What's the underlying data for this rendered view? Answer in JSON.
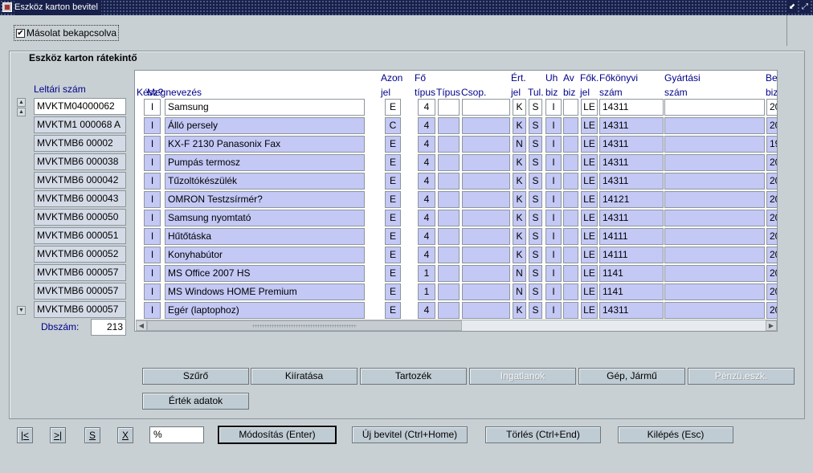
{
  "window": {
    "title": "Eszköz karton bevitel",
    "min_glyph": "⬋",
    "max_glyph": "⤢"
  },
  "copy_toggle": {
    "label": "Másolat bekapcsolva",
    "checked": true,
    "check_glyph": "✔"
  },
  "panel": {
    "title": "Eszköz karton rátekintő"
  },
  "left_column": {
    "header": "Leltári szám",
    "up_glyph": "▲",
    "down_glyph": "▼"
  },
  "columns": [
    {
      "key": "kesz",
      "label": "Kész?"
    },
    {
      "key": "megnevezes",
      "label": "Megnevezés"
    },
    {
      "key": "azon",
      "label": "Azon\njel"
    },
    {
      "key": "fotipus",
      "label": "Fő\ntípus"
    },
    {
      "key": "tipus",
      "label": "Típus"
    },
    {
      "key": "csop",
      "label": "Csop."
    },
    {
      "key": "ert",
      "label": "Ért.\njel"
    },
    {
      "key": "tul",
      "label": "Tul."
    },
    {
      "key": "uh",
      "label": "Uh\nbiz"
    },
    {
      "key": "av",
      "label": "Av\nbiz"
    },
    {
      "key": "fok",
      "label": "Fők.\njel"
    },
    {
      "key": "fokonyvi",
      "label": "Főkönyvi\nszám"
    },
    {
      "key": "gyartasi",
      "label": "Gyártási\nszám"
    },
    {
      "key": "be",
      "label": "Be\nbiz"
    }
  ],
  "rows": [
    {
      "leltari": "MVKTM04000062",
      "kesz": "I",
      "megnevezes": "Samsung",
      "azon": "E",
      "fotipus": "4",
      "tipus": "",
      "csop": "",
      "ert": "K",
      "tul": "S",
      "uh": "I",
      "av": "",
      "fok": "LE",
      "fokonyvi": "14311",
      "gyartasi": "",
      "be": "20"
    },
    {
      "leltari": "MVKTM1 000068 A",
      "kesz": "I",
      "megnevezes": "Álló persely",
      "azon": "C",
      "fotipus": "4",
      "tipus": "",
      "csop": "",
      "ert": "K",
      "tul": "S",
      "uh": "I",
      "av": "",
      "fok": "LE",
      "fokonyvi": "14311",
      "gyartasi": "",
      "be": "20"
    },
    {
      "leltari": "MVKTMB6 00002",
      "kesz": "I",
      "megnevezes": "KX-F 2130 Panasonix Fax",
      "azon": "E",
      "fotipus": "4",
      "tipus": "",
      "csop": "",
      "ert": "N",
      "tul": "S",
      "uh": "I",
      "av": "",
      "fok": "LE",
      "fokonyvi": "14311",
      "gyartasi": "",
      "be": "19"
    },
    {
      "leltari": "MVKTMB6 000038",
      "kesz": "I",
      "megnevezes": "Pumpás termosz",
      "azon": "E",
      "fotipus": "4",
      "tipus": "",
      "csop": "",
      "ert": "K",
      "tul": "S",
      "uh": "I",
      "av": "",
      "fok": "LE",
      "fokonyvi": "14311",
      "gyartasi": "",
      "be": "20"
    },
    {
      "leltari": "MVKTMB6 000042",
      "kesz": "I",
      "megnevezes": "Tűzoltókészülék",
      "azon": "E",
      "fotipus": "4",
      "tipus": "",
      "csop": "",
      "ert": "K",
      "tul": "S",
      "uh": "I",
      "av": "",
      "fok": "LE",
      "fokonyvi": "14311",
      "gyartasi": "",
      "be": "20"
    },
    {
      "leltari": "MVKTMB6 000043",
      "kesz": "I",
      "megnevezes": "OMRON Testzsírmér?",
      "azon": "E",
      "fotipus": "4",
      "tipus": "",
      "csop": "",
      "ert": "K",
      "tul": "S",
      "uh": "I",
      "av": "",
      "fok": "LE",
      "fokonyvi": "14121",
      "gyartasi": "",
      "be": "20"
    },
    {
      "leltari": "MVKTMB6 000050",
      "kesz": "I",
      "megnevezes": "Samsung nyomtató",
      "azon": "E",
      "fotipus": "4",
      "tipus": "",
      "csop": "",
      "ert": "K",
      "tul": "S",
      "uh": "I",
      "av": "",
      "fok": "LE",
      "fokonyvi": "14311",
      "gyartasi": "",
      "be": "20"
    },
    {
      "leltari": "MVKTMB6 000051",
      "kesz": "I",
      "megnevezes": "Hűtőtáska",
      "azon": "E",
      "fotipus": "4",
      "tipus": "",
      "csop": "",
      "ert": "K",
      "tul": "S",
      "uh": "I",
      "av": "",
      "fok": "LE",
      "fokonyvi": "14111",
      "gyartasi": "",
      "be": "20"
    },
    {
      "leltari": "MVKTMB6 000052",
      "kesz": "I",
      "megnevezes": "Konyhabútor",
      "azon": "E",
      "fotipus": "4",
      "tipus": "",
      "csop": "",
      "ert": "K",
      "tul": "S",
      "uh": "I",
      "av": "",
      "fok": "LE",
      "fokonyvi": "14111",
      "gyartasi": "",
      "be": "20"
    },
    {
      "leltari": "MVKTMB6 000057",
      "kesz": "I",
      "megnevezes": "MS Office 2007 HS",
      "azon": "E",
      "fotipus": "1",
      "tipus": "",
      "csop": "",
      "ert": "N",
      "tul": "S",
      "uh": "I",
      "av": "",
      "fok": "LE",
      "fokonyvi": "1141",
      "gyartasi": "",
      "be": "20"
    },
    {
      "leltari": "MVKTMB6 000057",
      "kesz": "I",
      "megnevezes": "MS Windows HOME Premium",
      "azon": "E",
      "fotipus": "1",
      "tipus": "",
      "csop": "",
      "ert": "N",
      "tul": "S",
      "uh": "I",
      "av": "",
      "fok": "LE",
      "fokonyvi": "1141",
      "gyartasi": "",
      "be": "20"
    },
    {
      "leltari": "MVKTMB6 000057",
      "kesz": "I",
      "megnevezes": "Egér (laptophoz)",
      "azon": "E",
      "fotipus": "4",
      "tipus": "",
      "csop": "",
      "ert": "K",
      "tul": "S",
      "uh": "I",
      "av": "",
      "fok": "LE",
      "fokonyvi": "14311",
      "gyartasi": "",
      "be": "20"
    }
  ],
  "hscroll": {
    "left_glyph": "◀",
    "right_glyph": "▶"
  },
  "count": {
    "label": "Dbszám:",
    "value": "213"
  },
  "action_buttons": [
    {
      "label": "Szűrő",
      "enabled": true
    },
    {
      "label": "Kiíratása",
      "enabled": true
    },
    {
      "label": "Tartozék",
      "enabled": true
    },
    {
      "label": "Ingatlanok",
      "enabled": false
    },
    {
      "label": "Gép, Jármű",
      "enabled": true
    },
    {
      "label": "Pénzü.eszk.",
      "enabled": false
    },
    {
      "label": "Érték adatok",
      "enabled": true
    }
  ],
  "nav_buttons": [
    {
      "label": "|<"
    },
    {
      "label": ">|"
    },
    {
      "label": "S"
    },
    {
      "label": "X"
    }
  ],
  "filter_value": "%",
  "bottom_buttons": [
    {
      "label": "Módosítás (Enter)"
    },
    {
      "label": "Új bevitel (Ctrl+Home)"
    },
    {
      "label": "Törlés (Ctrl+End)"
    },
    {
      "label": "Kilépés (Esc)"
    }
  ]
}
